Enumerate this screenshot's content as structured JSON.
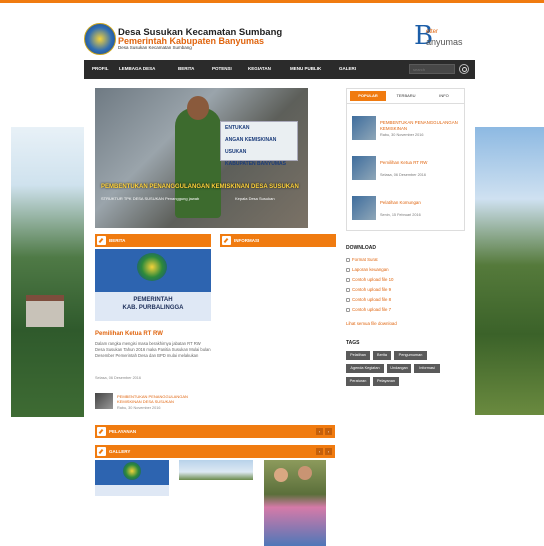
{
  "header": {
    "title": "Desa Susukan Kecamatan Sumbang",
    "subtitle": "Pemerintah Kabupaten Banyumas",
    "small": "Desa Susukan Kecamatan Sumbang",
    "brand_letter": "B",
    "brand_top": "etter",
    "brand_bottom": "anyumas"
  },
  "nav": {
    "items": [
      "PROFIL",
      "LEMBAGA DESA",
      "BERITA",
      "POTENSI",
      "KEGIATAN",
      "MENU PUBLIK",
      "GALERI"
    ],
    "search_placeholder": "search"
  },
  "slider": {
    "banner_lines": [
      "ENTUKAN",
      "ANGAN KEMISKINAN",
      "USUKAN",
      "KABUPATEN BANYUMAS"
    ],
    "caption": "PEMBENTUKAN PENANGGULANGAN KEMISKINAN DESA SUSUKAN",
    "sub_left": "STRUKTUR TPK DESA SUSUKAN   Penanggung jawab",
    "sub_right": "Kepala Desa Susukan"
  },
  "tabs": {
    "items": [
      "POPULAR",
      "TERBARU",
      "INFO"
    ],
    "posts": [
      {
        "title": "PEMBENTUKAN PENANGGULANGAN KEMISKINAN",
        "date": "Rabu, 30 November 2016"
      },
      {
        "title": "Pemilihan Ketua RT RW",
        "date": "Selasa, 06 Desember 2016"
      },
      {
        "title": "Pelatihan Komungan",
        "date": "Senin, 15 Februari 2016"
      }
    ]
  },
  "berita": {
    "heading": "BERITA",
    "img_line1": "PEMERINTAH",
    "img_line2": "KAB. PURBALINGGA",
    "post_title": "Pemilihan Ketua RT RW",
    "post_text": "Dalam rangka mengisi masa berakhirnya jabatan RT RW Desa Susukan Tahun 2016 maka Panitia Susukan Mulai bulan Desember Pemerintah Desa dan BPD mulai melakukan",
    "post_date": "Selasa, 06 Desember 2016",
    "post2_title": "PEMBENTUKAN PENANGGULANGAN KEMISKINAN DESA SUSUKAN",
    "post2_date": "Rabu, 30 November 2016"
  },
  "informasi": {
    "heading": "INFORMASI"
  },
  "download": {
    "heading": "DOWNLOAD",
    "items": [
      "Format Surat",
      "Laporan keuangan",
      "Contoh upload file 10",
      "Contoh upload file 9",
      "Contoh upload file 8",
      "Contoh upload file 7"
    ],
    "more": "Lihat semua file download"
  },
  "tags": {
    "heading": "TAGS",
    "items": [
      "Pelatihan",
      "Berita",
      "Pengumuman",
      "Agenda Kegiatan",
      "Undangan",
      "Informasi",
      "Peraturan",
      "Pelayanan"
    ]
  },
  "pelayanan": {
    "heading": "PELAYANAN"
  },
  "gallery": {
    "heading": "GALLERY"
  },
  "colors": {
    "accent": "#f07b10",
    "nav_bg": "#2b2b2b",
    "link": "#e0650f"
  }
}
